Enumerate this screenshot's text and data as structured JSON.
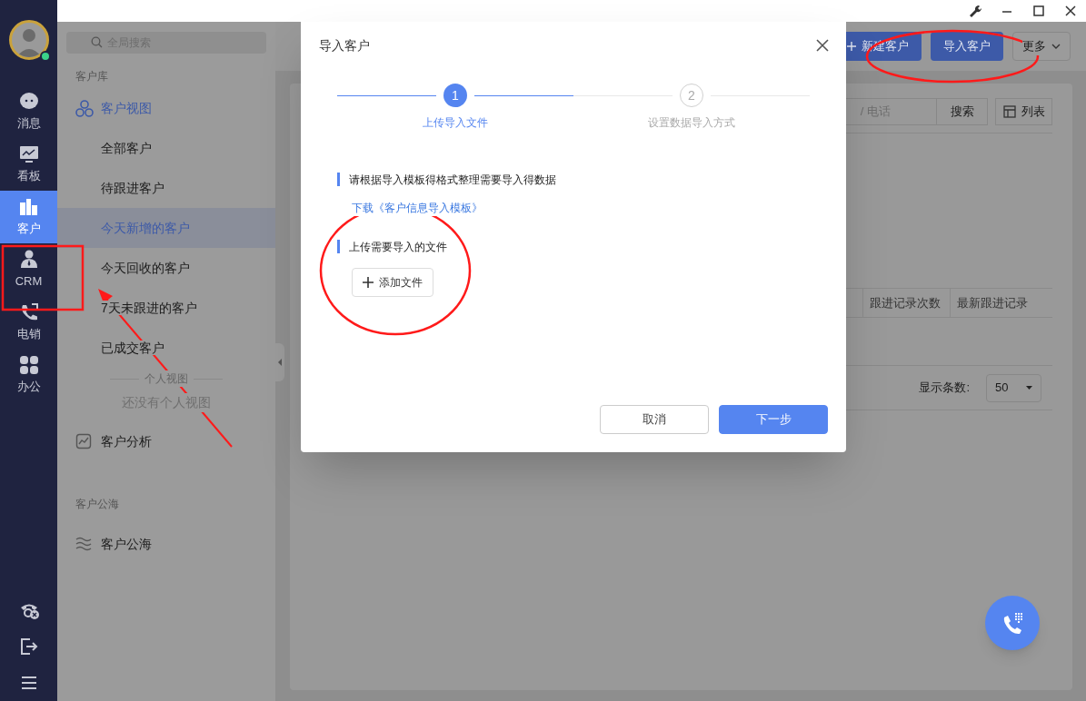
{
  "avatar": {
    "online": true
  },
  "nav": [
    {
      "label": "消息",
      "selected": false
    },
    {
      "label": "看板",
      "selected": false
    },
    {
      "label": "客户",
      "selected": true
    },
    {
      "label": "CRM",
      "selected": false
    },
    {
      "label": "电销",
      "selected": false
    },
    {
      "label": "办公",
      "selected": false
    }
  ],
  "sidebar": {
    "search": {
      "placeholder": "全局搜索"
    },
    "sections": [
      {
        "title": "客户库",
        "items": [
          {
            "kind": "group",
            "label": "客户视图",
            "children": [
              {
                "label": "全部客户",
                "selected": false
              },
              {
                "label": "待跟进客户",
                "selected": false
              },
              {
                "label": "今天新增的客户",
                "selected": true
              },
              {
                "label": "今天回收的客户",
                "selected": false
              },
              {
                "label": "7天未跟进的客户",
                "selected": false
              },
              {
                "label": "已成交客户",
                "selected": false
              }
            ],
            "divider_label": "个人视图",
            "empty_text": "还没有个人视图"
          },
          {
            "kind": "link",
            "label": "客户分析"
          }
        ]
      },
      {
        "title": "客户公海",
        "items": [
          {
            "kind": "link",
            "label": "客户公海"
          }
        ]
      }
    ]
  },
  "header_buttons": [
    {
      "label": "新建客户",
      "kind": "primary"
    },
    {
      "label": "导入客户",
      "kind": "primary"
    },
    {
      "label": "更多",
      "kind": "dropdown"
    }
  ],
  "toolbar": {
    "search": {
      "placeholder": "/ 电话"
    },
    "search_button": "搜索",
    "view_button": "列表"
  },
  "table": {
    "columns": [
      "跟进记录次数",
      "最新跟进记录"
    ]
  },
  "pagination": {
    "label": "显示条数:",
    "page_size": "50"
  },
  "dialog": {
    "title": "导入客户",
    "steps": [
      {
        "number": "1",
        "label": "上传导入文件",
        "selected": true
      },
      {
        "number": "2",
        "label": "设置数据导入方式",
        "selected": false
      }
    ],
    "sections": [
      {
        "kind": "link",
        "title": "请根据导入模板得格式整理需要导入得数据",
        "link": "下载《客户信息导入模板》"
      },
      {
        "kind": "upload",
        "title": "上传需要导入的文件",
        "button": "添加文件"
      }
    ],
    "buttons": [
      {
        "label": "取消",
        "kind": "default"
      },
      {
        "label": "下一步",
        "kind": "primary"
      }
    ]
  },
  "annotations": [
    {
      "kind": "ellipse"
    },
    {
      "kind": "ellipse"
    },
    {
      "kind": "rectangle"
    },
    {
      "kind": "arrow"
    }
  ]
}
